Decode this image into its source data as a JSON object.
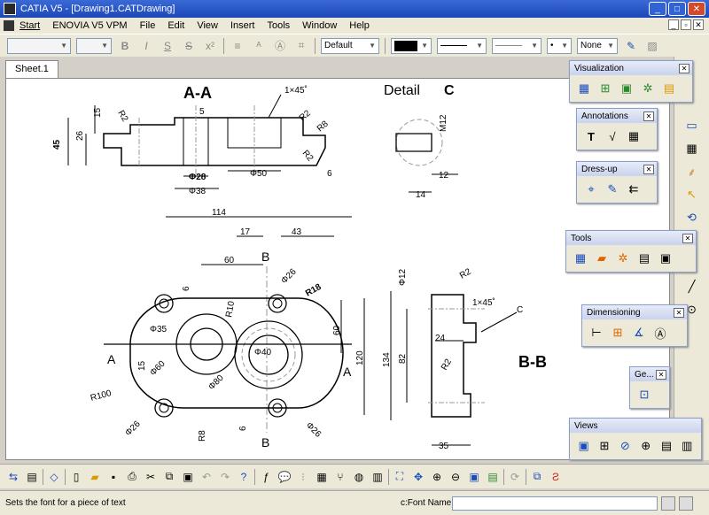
{
  "window": {
    "title": "CATIA V5 - [Drawing1.CATDrawing]"
  },
  "menu": {
    "start": "Start",
    "items": [
      "ENOVIA V5 VPM",
      "File",
      "Edit",
      "View",
      "Insert",
      "Tools",
      "Window",
      "Help"
    ]
  },
  "format": {
    "style_value": "Default",
    "linetype_value": "None"
  },
  "sheet_tab": "Sheet.1",
  "drawing": {
    "section_title": "A-A",
    "detail_title": "Detail",
    "detail_letter": "C",
    "view_bb": "B-B",
    "labels": {
      "chamfer1": "1×45˚",
      "chamfer2": "1×45˚",
      "r2a": "R2",
      "r2b": "R2",
      "r2c": "R2",
      "r2d": "R2",
      "r8a": "R8",
      "r8b": "R8",
      "m12": "M12",
      "d15": "15",
      "d26": "26",
      "d45": "45",
      "d5": "5",
      "phi28": "Φ28",
      "phi38": "Φ38",
      "phi50": "Φ50",
      "d6a": "6",
      "d12": "12",
      "d14": "14",
      "d114": "114",
      "d17": "17",
      "d43": "43",
      "d60a": "60",
      "bmark1": "B",
      "bmark2": "B",
      "amark1": "A",
      "amark2": "A",
      "phi26a": "Φ26",
      "phi26b": "Φ26",
      "phi26c": "Φ26",
      "r18": "R18",
      "r10": "R10",
      "d6b": "6",
      "d6c": "6",
      "phi35": "Φ35",
      "phi60": "Φ60",
      "phi40": "Φ40",
      "phi80": "Φ80",
      "d15b": "15",
      "d60b": "60",
      "d120": "120",
      "r100": "R100",
      "phi12": "Φ12",
      "d134": "134",
      "d82": "82",
      "d24": "24",
      "c": "C",
      "d35": "35"
    }
  },
  "panels": {
    "visualization": "Visualization",
    "annotations": "Annotations",
    "dressup": "Dress-up",
    "tools": "Tools",
    "dimensioning": "Dimensioning",
    "geometry": "Ge...",
    "views": "Views"
  },
  "status": {
    "message": "Sets the font for a piece of text",
    "command_label": "c:Font Name"
  }
}
